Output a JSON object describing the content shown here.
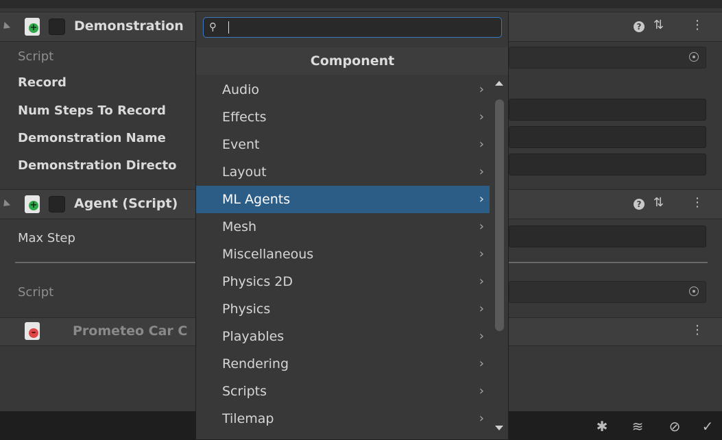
{
  "components": [
    {
      "title": "Demonstration",
      "enabled": false
    },
    {
      "title": "Agent (Script)",
      "enabled": false
    },
    {
      "title": "Prometeo Car C"
    }
  ],
  "demonstration_fields": {
    "script": "Script",
    "record": "Record",
    "num_steps": "Num Steps To Record",
    "demo_name": "Demonstration Name",
    "demo_dir": "Demonstration Directo"
  },
  "agent_fields": {
    "max_step": "Max Step",
    "script": "Script"
  },
  "popup": {
    "search_value": "",
    "title": "Component",
    "items": [
      {
        "label": "Audio"
      },
      {
        "label": "Effects"
      },
      {
        "label": "Event"
      },
      {
        "label": "Layout"
      },
      {
        "label": "ML Agents",
        "selected": true
      },
      {
        "label": "Mesh"
      },
      {
        "label": "Miscellaneous"
      },
      {
        "label": "Physics 2D"
      },
      {
        "label": "Physics"
      },
      {
        "label": "Playables"
      },
      {
        "label": "Rendering"
      },
      {
        "label": "Scripts"
      },
      {
        "label": "Tilemap"
      }
    ],
    "arrow": "›"
  },
  "icons": {
    "help": "?",
    "presets": "⇅",
    "menu": "⋮",
    "search": "⚲"
  },
  "colors": {
    "selection": "#2c5d87",
    "search_border": "#3a79c4",
    "add_badge": "#2fa84a",
    "remove_badge": "#e04545"
  }
}
